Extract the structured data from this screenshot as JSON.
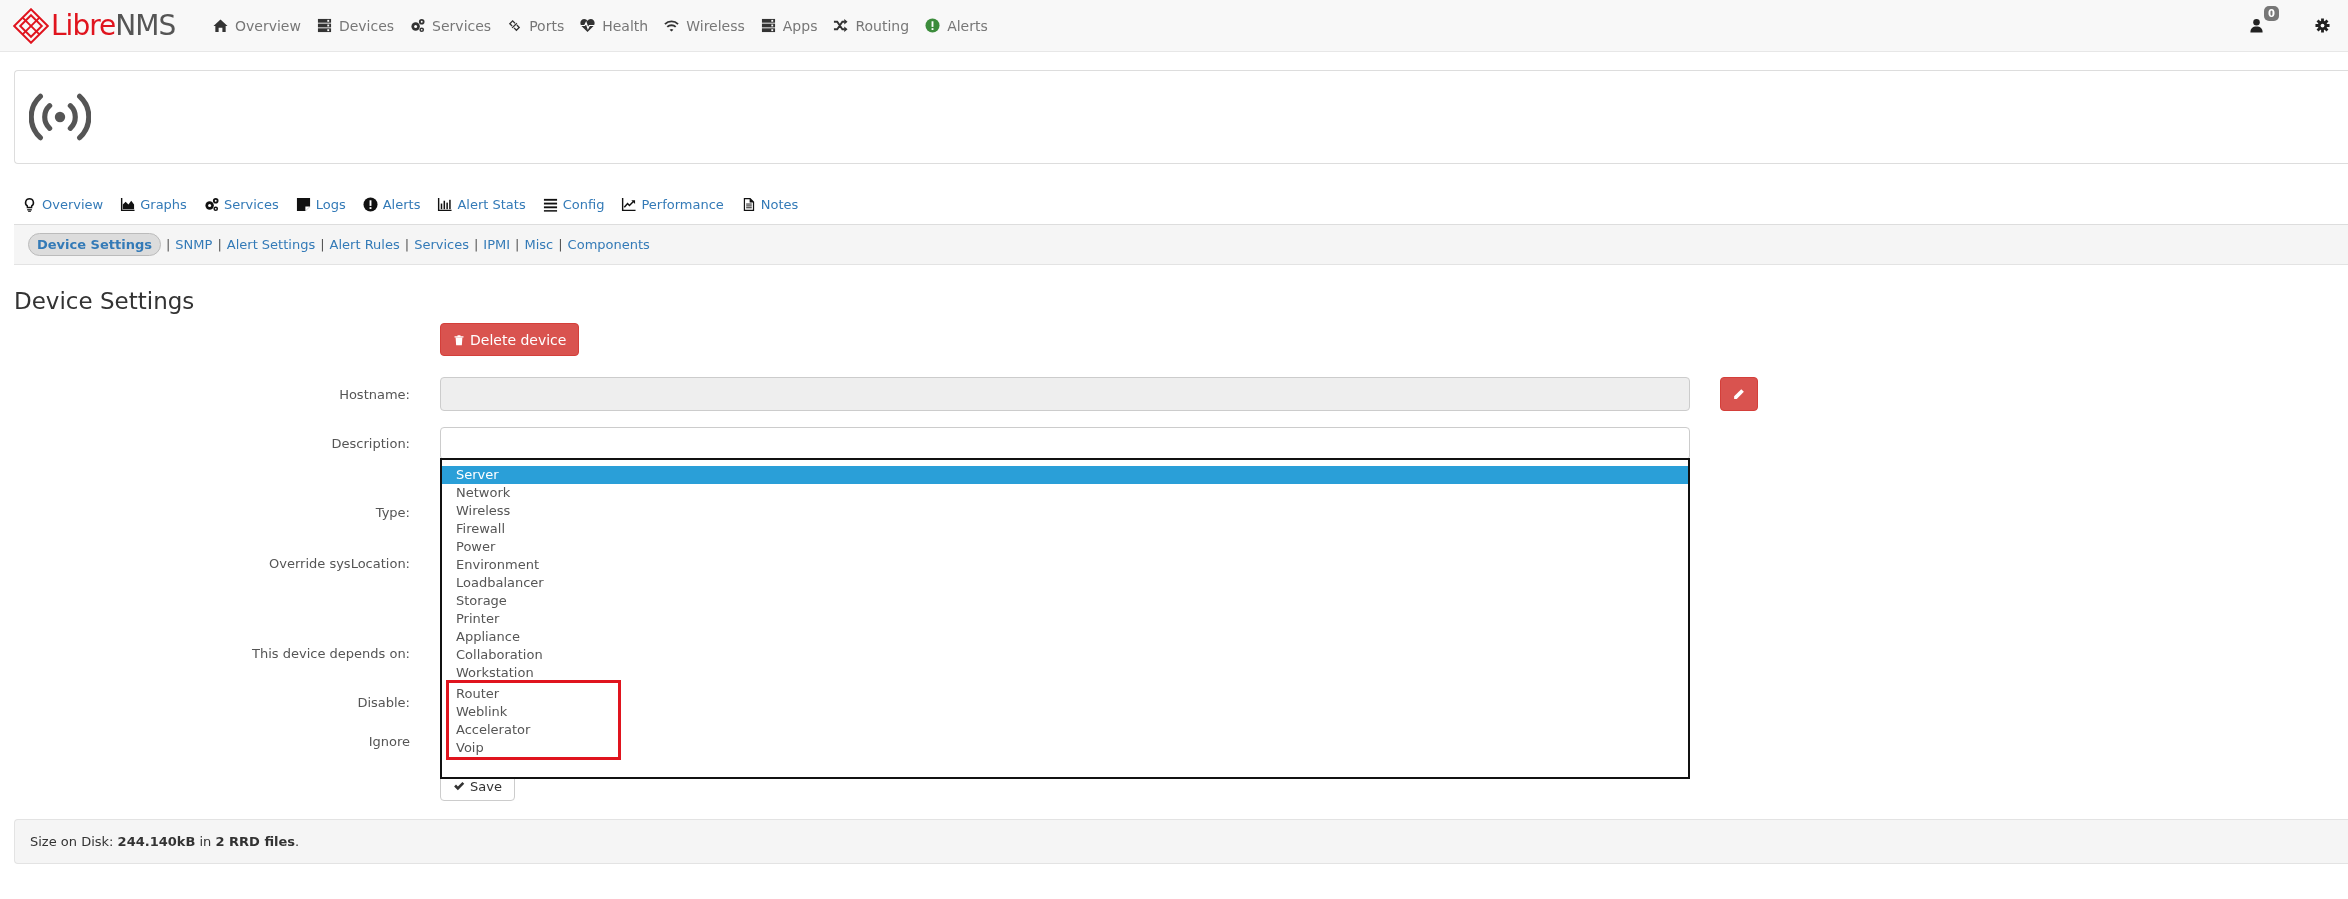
{
  "navbar": {
    "logo": {
      "brand": "Libre",
      "suffix": "NMS"
    },
    "items": [
      {
        "label": "Overview"
      },
      {
        "label": "Devices"
      },
      {
        "label": "Services"
      },
      {
        "label": "Ports"
      },
      {
        "label": "Health"
      },
      {
        "label": "Wireless"
      },
      {
        "label": "Apps"
      },
      {
        "label": "Routing"
      },
      {
        "label": "Alerts"
      }
    ],
    "notification_count": "0"
  },
  "device_tabs": [
    {
      "label": "Overview"
    },
    {
      "label": "Graphs"
    },
    {
      "label": "Services"
    },
    {
      "label": "Logs"
    },
    {
      "label": "Alerts"
    },
    {
      "label": "Alert Stats"
    },
    {
      "label": "Config"
    },
    {
      "label": "Performance"
    },
    {
      "label": "Notes"
    }
  ],
  "settings_nav": [
    {
      "kind": "link",
      "label": "Device Settings",
      "selected": true
    },
    {
      "kind": "separator",
      "label": "|"
    },
    {
      "kind": "link",
      "label": "SNMP",
      "selected": false
    },
    {
      "kind": "separator",
      "label": "|"
    },
    {
      "kind": "link",
      "label": "Alert Settings",
      "selected": false
    },
    {
      "kind": "separator",
      "label": "|"
    },
    {
      "kind": "link",
      "label": "Alert Rules",
      "selected": false
    },
    {
      "kind": "separator",
      "label": "|"
    },
    {
      "kind": "link",
      "label": "Services",
      "selected": false
    },
    {
      "kind": "separator",
      "label": "|"
    },
    {
      "kind": "link",
      "label": "IPMI",
      "selected": false
    },
    {
      "kind": "separator",
      "label": "|"
    },
    {
      "kind": "link",
      "label": "Misc",
      "selected": false
    },
    {
      "kind": "separator",
      "label": "|"
    },
    {
      "kind": "link",
      "label": "Components",
      "selected": false
    }
  ],
  "page_title": "Device Settings",
  "form": {
    "delete_button": "Delete device",
    "rows": [
      {
        "kind": "text",
        "label": "Hostname:",
        "disabled": true,
        "edit_button": true
      },
      {
        "kind": "text",
        "label": "Description:",
        "disabled": false,
        "edit_button": false
      },
      {
        "kind": "select",
        "label": "Type:",
        "expanded": true,
        "options": [
          {
            "label": "Server",
            "selected": true,
            "highlighted": false
          },
          {
            "label": "Network",
            "selected": false,
            "highlighted": false
          },
          {
            "label": "Wireless",
            "selected": false,
            "highlighted": false
          },
          {
            "label": "Firewall",
            "selected": false,
            "highlighted": false
          },
          {
            "label": "Power",
            "selected": false,
            "highlighted": false
          },
          {
            "label": "Environment",
            "selected": false,
            "highlighted": false
          },
          {
            "label": "Loadbalancer",
            "selected": false,
            "highlighted": false
          },
          {
            "label": "Storage",
            "selected": false,
            "highlighted": false
          },
          {
            "label": "Printer",
            "selected": false,
            "highlighted": false
          },
          {
            "label": "Appliance",
            "selected": false,
            "highlighted": false
          },
          {
            "label": "Collaboration",
            "selected": false,
            "highlighted": false
          },
          {
            "label": "Workstation",
            "selected": false,
            "highlighted": false
          },
          {
            "label": "Router",
            "selected": false,
            "highlighted": true
          },
          {
            "label": "Weblink",
            "selected": false,
            "highlighted": true
          },
          {
            "label": "Accelerator",
            "selected": false,
            "highlighted": true
          },
          {
            "label": "Voip",
            "selected": false,
            "highlighted": true
          }
        ]
      },
      {
        "kind": "label",
        "label": "Override sysLocation:"
      },
      {
        "kind": "label",
        "label": "This device depends on:"
      },
      {
        "kind": "label",
        "label": "Disable:"
      },
      {
        "kind": "label",
        "label": "Ignore"
      }
    ],
    "save_button": "Save"
  },
  "footer": {
    "text": "Size on Disk: **244.140kB** in **2 RRD files**."
  }
}
